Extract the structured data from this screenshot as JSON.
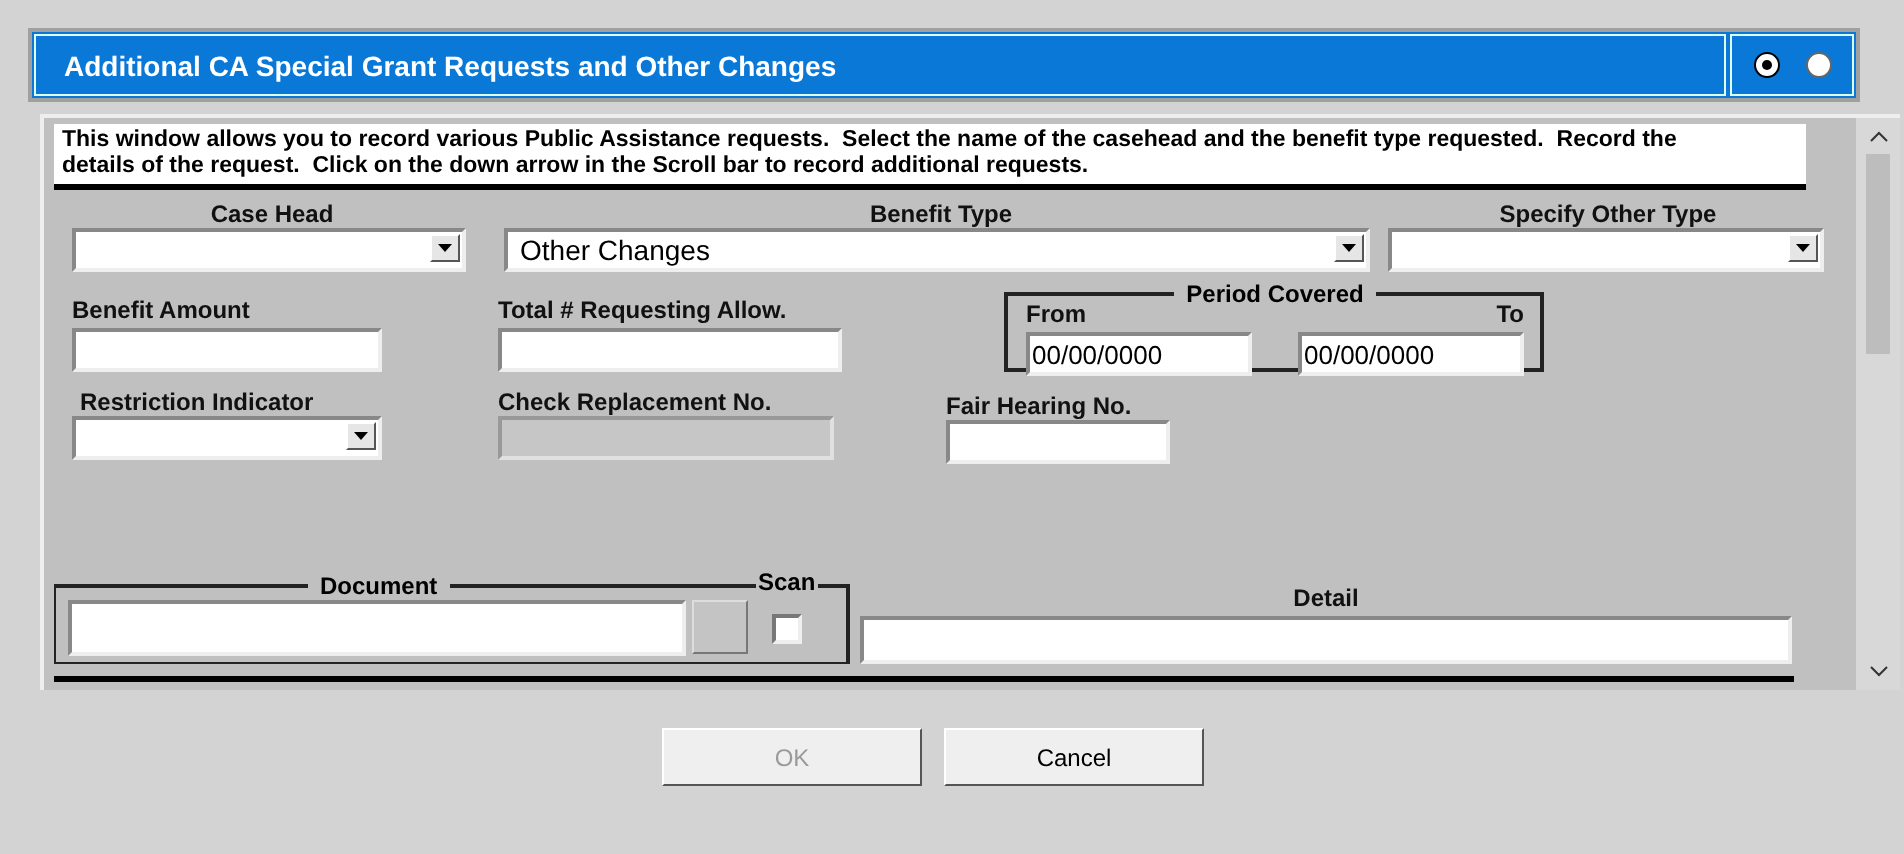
{
  "header": {
    "title": "Additional CA Special Grant Requests and Other Changes",
    "radios": [
      {
        "selected": true
      },
      {
        "selected": false
      }
    ]
  },
  "description": "This window allows you to record various Public Assistance requests.  Select the name of the casehead and the benefit type requested.  Record the details of the request.  Click on the down arrow in the Scroll bar to record additional requests.",
  "case_head": {
    "label": "Case Head",
    "kind": "dropdown"
  },
  "benefit_type": {
    "label": "Benefit Type",
    "kind": "dropdown",
    "value": "Other Changes"
  },
  "specify_other_type": {
    "label": "Specify Other Type",
    "kind": "dropdown"
  },
  "benefit_amount": {
    "label": "Benefit Amount",
    "kind": "text"
  },
  "total_requesting": {
    "label": "Total # Requesting Allow.",
    "kind": "text"
  },
  "period_covered": {
    "label": "Period Covered",
    "from": {
      "label": "From",
      "value": "00/00/0000"
    },
    "to": {
      "label": "To",
      "value": "00/00/0000"
    }
  },
  "restriction_indicator": {
    "label": "Restriction Indicator",
    "kind": "dropdown"
  },
  "check_replacement": {
    "label": "Check Replacement No.",
    "kind": "disabled"
  },
  "fair_hearing": {
    "label": "Fair Hearing No.",
    "kind": "text"
  },
  "document": {
    "label": "Document"
  },
  "scan": {
    "label": "Scan",
    "checked": false
  },
  "detail": {
    "label": "Detail"
  },
  "buttons": [
    {
      "label": "OK",
      "disabled": true
    },
    {
      "label": "Cancel",
      "disabled": false
    }
  ]
}
